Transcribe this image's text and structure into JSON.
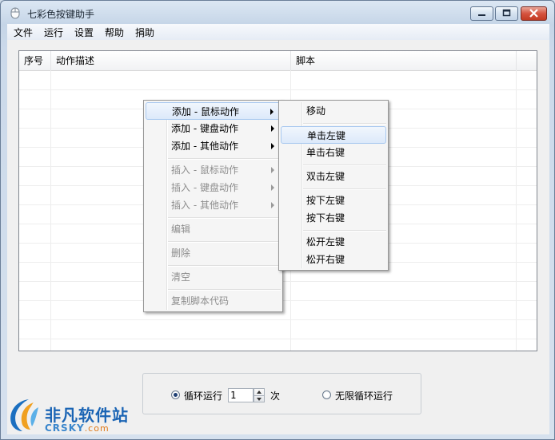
{
  "window": {
    "title": "七彩色按键助手"
  },
  "menubar": [
    "文件",
    "运行",
    "设置",
    "帮助",
    "捐助"
  ],
  "table": {
    "columns": [
      "序号",
      "动作描述",
      "脚本"
    ],
    "rows": []
  },
  "context_menu": {
    "items": [
      {
        "label": "添加 - 鼠标动作",
        "submenu": true,
        "disabled": false,
        "highlighted": true
      },
      {
        "label": "添加 - 键盘动作",
        "submenu": true,
        "disabled": false
      },
      {
        "label": "添加 - 其他动作",
        "submenu": true,
        "disabled": false
      },
      {
        "label": "插入 - 鼠标动作",
        "submenu": true,
        "disabled": true
      },
      {
        "label": "插入 - 键盘动作",
        "submenu": true,
        "disabled": true
      },
      {
        "label": "插入 - 其他动作",
        "submenu": true,
        "disabled": true
      },
      {
        "label": "编辑",
        "disabled": true
      },
      {
        "label": "删除",
        "disabled": true
      },
      {
        "label": "清空",
        "disabled": true
      },
      {
        "label": "复制脚本代码",
        "disabled": true
      }
    ]
  },
  "submenu": {
    "items": [
      {
        "label": "移动"
      },
      {
        "label": "单击左键",
        "highlighted": true
      },
      {
        "label": "单击右键"
      },
      {
        "label": "双击左键"
      },
      {
        "label": "按下左键"
      },
      {
        "label": "按下右键"
      },
      {
        "label": "松开左键"
      },
      {
        "label": "松开右键"
      }
    ]
  },
  "loop": {
    "mode_loop_label": "循环运行",
    "count": "1",
    "unit": "次",
    "mode_infinite_label": "无限循环运行",
    "selected": "loop"
  },
  "watermark": {
    "text": "非凡软件站",
    "domain": "CRSKY",
    "suffix": ".com"
  }
}
